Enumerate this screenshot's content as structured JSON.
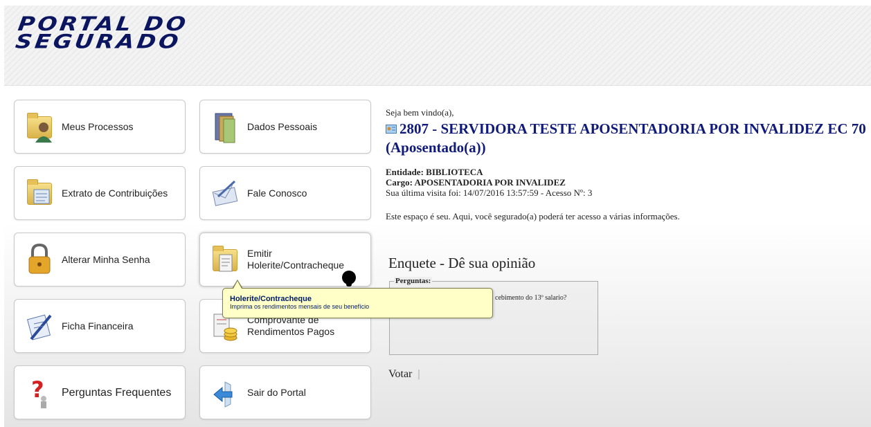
{
  "header": {
    "logo_line1": "PORTAL DO",
    "logo_line2": "SEGURADO"
  },
  "menu": {
    "meus_processos": "Meus Processos",
    "dados_pessoais": "Dados Pessoais",
    "extrato": "Extrato de Contribuições",
    "fale_conosco": "Fale Conosco",
    "alterar_senha": "Alterar Minha Senha",
    "emitir_holerite": "Emitir Holerite/Contracheque",
    "ficha_financeira": "Ficha Financeira",
    "comprovante_line1": "Comprovante de",
    "comprovante_line2": "Rendimentos Pagos",
    "perguntas": "Perguntas Frequentes",
    "sair": "Sair do Portal"
  },
  "welcome": {
    "greeting": "Seja bem vindo(a),",
    "name_line1": "2807 - SERVIDORA TESTE APOSENTADORIA POR INVALIDEZ EC 70",
    "name_line2": "(Aposentado(a))",
    "entidade": "Entidade: BIBLIOTECA",
    "cargo": "Cargo: APOSENTADORIA POR INVALIDEZ",
    "last_visit": "Sua última visita foi: 14/07/2016 13:57:59 - Acesso Nº: 3",
    "description": "Este espaço é seu. Aqui, você segurado(a) poderá ter acesso a várias informações."
  },
  "poll": {
    "title": "Enquete - Dê sua opinião",
    "legend": "Perguntas:",
    "question_visible": "cebimento do 13º salario?",
    "vote_label": "Votar",
    "separator": "|"
  },
  "tooltip": {
    "title": "Holerite/Contracheque",
    "description": "Imprima os rendimentos mensais de seu benefício"
  }
}
